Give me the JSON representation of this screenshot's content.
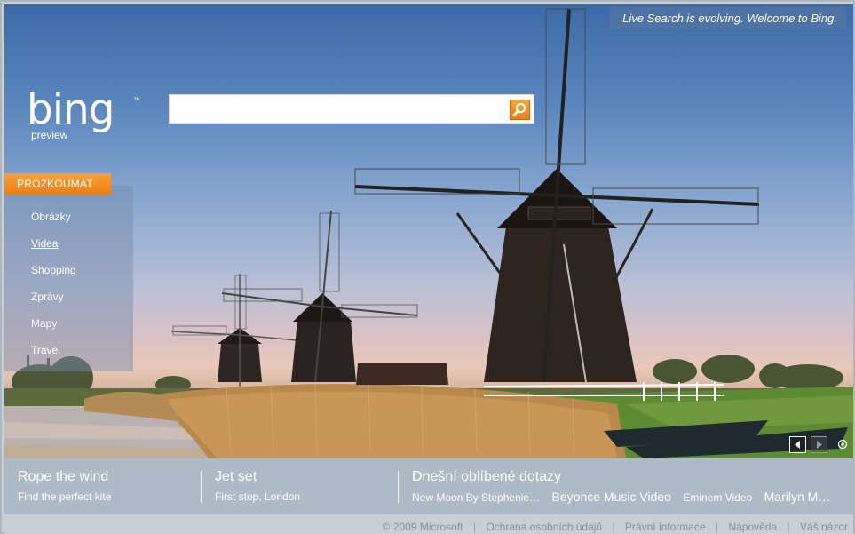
{
  "welcome_banner": "Live Search is evolving. Welcome to Bing.",
  "logo": {
    "word": "bing",
    "tm": "™",
    "tag": "preview"
  },
  "search": {
    "value": "",
    "placeholder": ""
  },
  "explore": {
    "heading": "PROZKOUMAT",
    "items": [
      {
        "label": "Obrázky",
        "active": false
      },
      {
        "label": "Videa",
        "active": true
      },
      {
        "label": "Shopping",
        "active": false
      },
      {
        "label": "Zprávy",
        "active": false
      },
      {
        "label": "Mapy",
        "active": false
      },
      {
        "label": "Travel",
        "active": false
      }
    ]
  },
  "strip": {
    "col1": {
      "title": "Rope the wind",
      "subtitle": "Find the perfect kite"
    },
    "col2": {
      "title": "Jet set",
      "subtitle": "First stop, London"
    },
    "col3": {
      "title": "Dnešní oblíbené dotazy",
      "queries": [
        "New Moon By Stephenie…",
        "Beyonce Music Video",
        "Eminem Video",
        "Marilyn M…"
      ]
    }
  },
  "footer": {
    "copyright": "© 2009 Microsoft",
    "links": [
      "Ochrana osobních údajů",
      "Právní informace",
      "Nápověda",
      "Váš názor"
    ]
  },
  "colors": {
    "accent_orange": "#ec7e12",
    "strip_bg": "#aebac6",
    "footer_text": "#888f97"
  },
  "icons": [
    "search-icon",
    "prev-arrow-icon",
    "next-arrow-icon",
    "hotspot-icon"
  ]
}
